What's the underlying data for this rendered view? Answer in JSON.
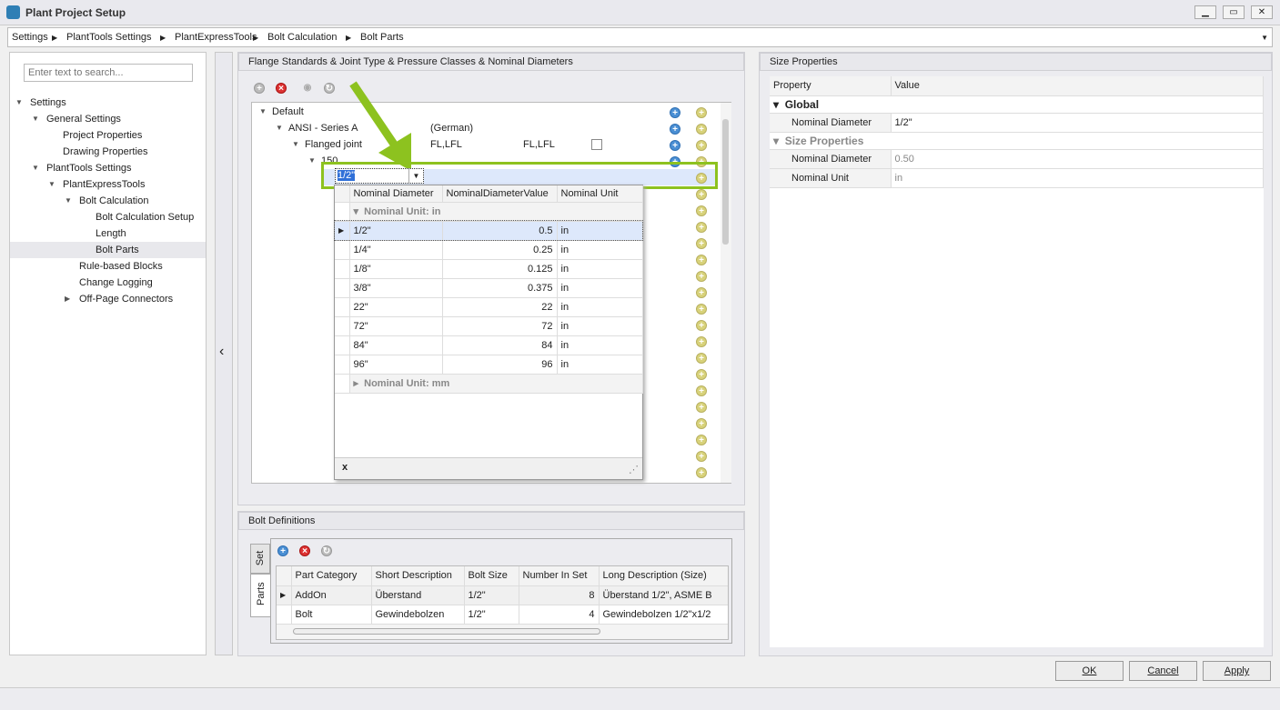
{
  "window": {
    "title": "Plant Project Setup",
    "min": "▁",
    "max": "▭",
    "close": "✕"
  },
  "breadcrumb": [
    "Settings",
    "PlantTools Settings",
    "PlantExpressTools",
    "Bolt Calculation",
    "Bolt Parts"
  ],
  "sidebar": {
    "search_placeholder": "Enter text to search...",
    "items": [
      {
        "label": "Settings",
        "level": 0,
        "exp": "open"
      },
      {
        "label": "General Settings",
        "level": 1,
        "exp": "open"
      },
      {
        "label": "Project Properties",
        "level": 2,
        "exp": ""
      },
      {
        "label": "Drawing Properties",
        "level": 2,
        "exp": ""
      },
      {
        "label": "PlantTools Settings",
        "level": 1,
        "exp": "open"
      },
      {
        "label": "PlantExpressTools",
        "level": 2,
        "exp": "open"
      },
      {
        "label": "Bolt Calculation",
        "level": 3,
        "exp": "open"
      },
      {
        "label": "Bolt Calculation Setup",
        "level": 4,
        "exp": ""
      },
      {
        "label": "Length",
        "level": 4,
        "exp": ""
      },
      {
        "label": "Bolt Parts",
        "level": 4,
        "exp": "",
        "selected": true
      },
      {
        "label": "Rule-based Blocks",
        "level": 3,
        "exp": ""
      },
      {
        "label": "Change Logging",
        "level": 3,
        "exp": ""
      },
      {
        "label": "Off-Page Connectors",
        "level": 3,
        "exp": "closed"
      }
    ]
  },
  "flange": {
    "title": "Flange Standards & Joint Type & Pressure Classes & Nominal Diameters",
    "tree": [
      {
        "c1": "Default",
        "c2": "",
        "c3": "",
        "level": 0,
        "check": false
      },
      {
        "c1": "ANSI - Series A",
        "c2": "(German)",
        "c3": "",
        "level": 1,
        "check": false
      },
      {
        "c1": "Flanged joint",
        "c2": "FL,LFL",
        "c3": "FL,LFL",
        "level": 2,
        "check": true
      },
      {
        "c1": "150",
        "c2": "",
        "c3": "",
        "level": 3,
        "check": false
      }
    ],
    "editor_value": "1/2\"",
    "dropdown": {
      "columns": [
        "Nominal Diameter",
        "NominalDiameterValue",
        "Nominal Unit"
      ],
      "group_in": "Nominal Unit: in",
      "group_mm": "Nominal Unit: mm",
      "rows": [
        [
          "1/2\"",
          "0.5",
          "in"
        ],
        [
          "1/4\"",
          "0.25",
          "in"
        ],
        [
          "1/8\"",
          "0.125",
          "in"
        ],
        [
          "3/8\"",
          "0.375",
          "in"
        ],
        [
          "22\"",
          "22",
          "in"
        ],
        [
          "72\"",
          "72",
          "in"
        ],
        [
          "84\"",
          "84",
          "in"
        ],
        [
          "96\"",
          "96",
          "in"
        ]
      ],
      "close": "x"
    }
  },
  "bolts": {
    "title": "Bolt Definitions",
    "tabs": [
      "Set",
      "Parts"
    ],
    "columns": [
      "Part Category",
      "Short Description",
      "Bolt Size",
      "Number In Set",
      "Long Description (Size)"
    ],
    "rows": [
      [
        "AddOn",
        "Überstand",
        "1/2\"",
        "8",
        "Überstand 1/2\", ASME B"
      ],
      [
        "Bolt",
        "Gewindebolzen",
        "1/2\"",
        "4",
        "Gewindebolzen 1/2\"x1/2"
      ]
    ]
  },
  "size": {
    "title": "Size Properties",
    "col_property": "Property",
    "col_value": "Value",
    "global": "Global",
    "global_rows": [
      [
        "Nominal Diameter",
        "1/2\""
      ]
    ],
    "section": "Size Properties",
    "section_rows": [
      [
        "Nominal Diameter",
        "0.50"
      ],
      [
        "Nominal Unit",
        "in"
      ]
    ]
  },
  "buttons": {
    "ok": "OK",
    "cancel": "Cancel",
    "apply": "Apply"
  },
  "colors": {
    "accent": "#8dc21f",
    "selection": "#dde8fb"
  }
}
